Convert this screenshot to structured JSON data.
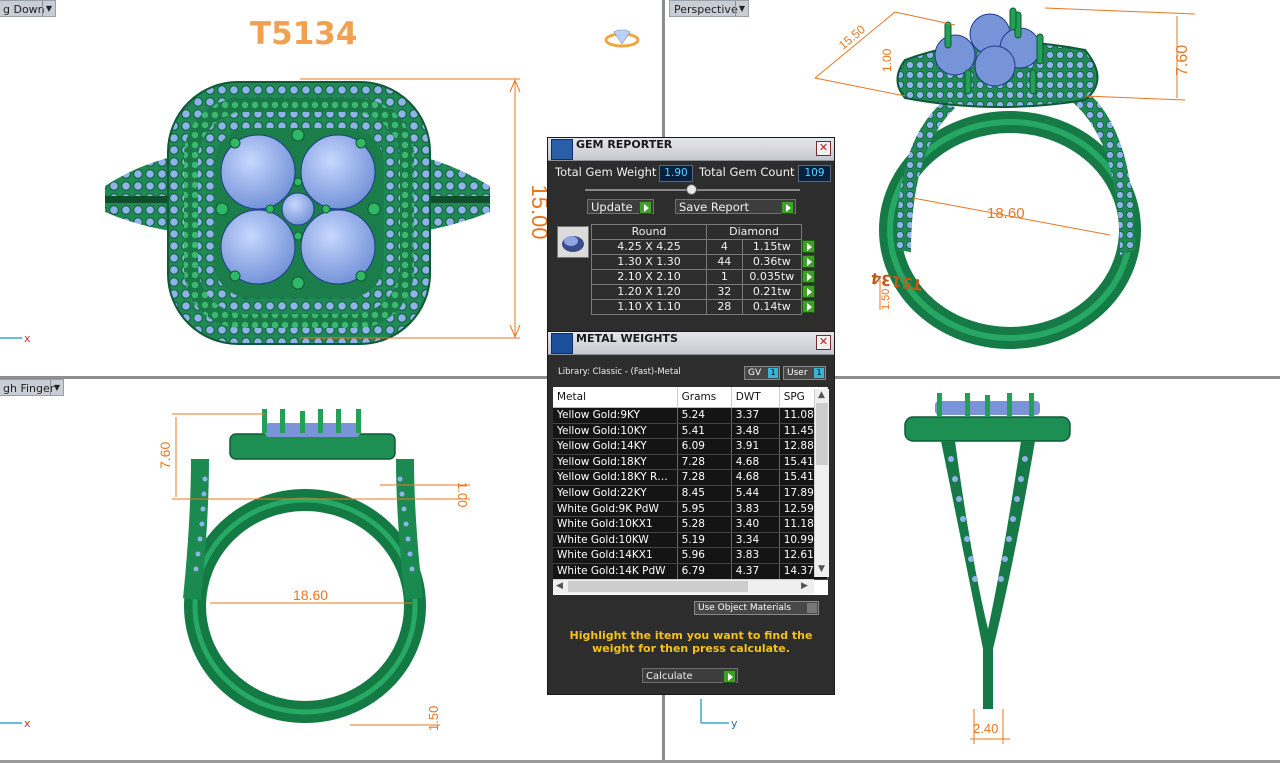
{
  "viewports": {
    "top_left": {
      "label": "g Down",
      "title": "T5134",
      "dims": {
        "height": "15.00"
      }
    },
    "top_right": {
      "label": "Perspective",
      "dims": {
        "width": "15.50",
        "prong": "1.00",
        "height": "7.60",
        "inner": "18.60",
        "band": "1.50"
      },
      "engraving": "T5134"
    },
    "bottom_left": {
      "label": "gh Finger",
      "dims": {
        "height": "7.60",
        "prong": "1.00",
        "inner": "18.60",
        "band": "1.50"
      }
    },
    "bottom_right": {
      "dims": {
        "band_width": "2.40"
      }
    }
  },
  "axes": {
    "x": "x",
    "y": "y"
  },
  "gem_reporter": {
    "title": "GEM REPORTER",
    "total_weight_label": "Total Gem Weight",
    "total_weight_value": "1.90",
    "total_count_label": "Total Gem Count",
    "total_count_value": "109",
    "update_label": "Update",
    "save_report_label": "Save Report",
    "table": {
      "col_shape": "Round",
      "col_type": "Diamond",
      "rows": [
        {
          "size": "4.25 X 4.25",
          "count": "4",
          "weight": "1.15tw"
        },
        {
          "size": "1.30 X 1.30",
          "count": "44",
          "weight": "0.36tw"
        },
        {
          "size": "2.10 X 2.10",
          "count": "1",
          "weight": "0.035tw"
        },
        {
          "size": "1.20 X 1.20",
          "count": "32",
          "weight": "0.21tw"
        },
        {
          "size": "1.10 X 1.10",
          "count": "28",
          "weight": "0.14tw"
        }
      ]
    }
  },
  "metal_weights": {
    "title": "METAL WEIGHTS",
    "library_label": "Library: Classic - (Fast)-Metal",
    "gv_label": "GV",
    "user_label": "User",
    "toggle_value": "1",
    "columns": [
      "Metal",
      "Grams",
      "DWT",
      "SPG"
    ],
    "rows": [
      [
        "Yellow Gold:9KY",
        "5.24",
        "3.37",
        "11.08"
      ],
      [
        "Yellow Gold:10KY",
        "5.41",
        "3.48",
        "11.45"
      ],
      [
        "Yellow Gold:14KY",
        "6.09",
        "3.91",
        "12.88"
      ],
      [
        "Yellow Gold:18KY",
        "7.28",
        "4.68",
        "15.41"
      ],
      [
        "Yellow Gold:18KY R…",
        "7.28",
        "4.68",
        "15.41"
      ],
      [
        "Yellow Gold:22KY",
        "8.45",
        "5.44",
        "17.89"
      ],
      [
        "White Gold:9K PdW",
        "5.95",
        "3.83",
        "12.59"
      ],
      [
        "White Gold:10KX1",
        "5.28",
        "3.40",
        "11.18"
      ],
      [
        "White Gold:10KW",
        "5.19",
        "3.34",
        "10.99"
      ],
      [
        "White Gold:14KX1",
        "5.96",
        "3.83",
        "12.61"
      ],
      [
        "White Gold:14K PdW",
        "6.79",
        "4.37",
        "14.37"
      ]
    ],
    "use_object_materials_label": "Use Object Materials",
    "hint": "Highlight the item you want to find the weight for then press calculate.",
    "calculate_label": "Calculate"
  }
}
